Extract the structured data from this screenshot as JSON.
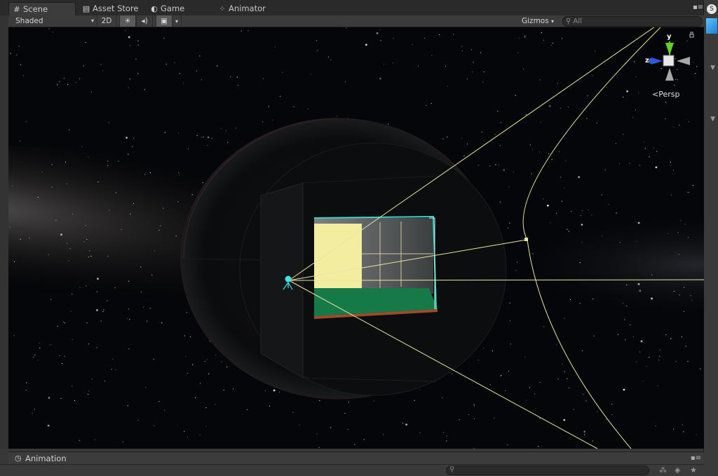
{
  "tabs": [
    {
      "label": "Scene",
      "icon": "grid-icon",
      "active": true
    },
    {
      "label": "Asset Store",
      "icon": "store-icon",
      "active": false
    },
    {
      "label": "Game",
      "icon": "game-icon",
      "active": false
    },
    {
      "label": "Animator",
      "icon": "animator-icon",
      "active": false
    }
  ],
  "toolbar": {
    "draw_mode": "Shaded",
    "mode_2d": "2D",
    "lighting_icon": "sun-icon",
    "audio_icon": "audio-icon",
    "effects_icon": "image-icon",
    "gizmos_label": "Gizmos",
    "search_placeholder": "All"
  },
  "orientation_gizmo": {
    "y_label": "y",
    "z_label": "z",
    "projection_label": "Persp",
    "colors": {
      "y": "#5fd12c",
      "z": "#2a5bdc",
      "neutral": "#a8a8a8"
    }
  },
  "scene_colors": {
    "frustum": "#e8e6a0",
    "room_wall": "#f3eda0",
    "floor": "#157a48",
    "edge_glow": "#3fd3c7",
    "camera_icon": "#3ee3ee"
  },
  "bottom_panel": {
    "title": "Animation",
    "icon": "clock-icon"
  }
}
